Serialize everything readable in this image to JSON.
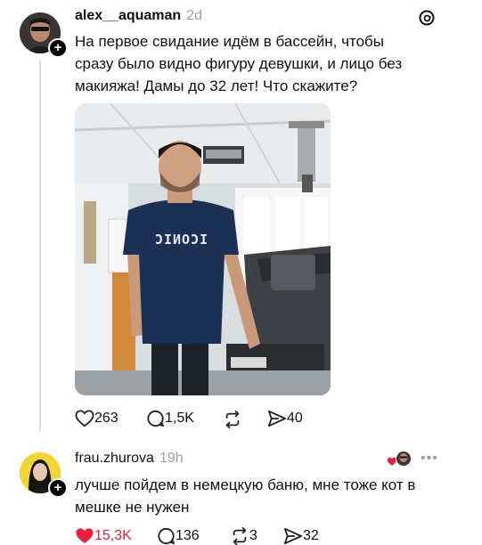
{
  "post": {
    "username": "alex__aquaman",
    "time": "2d",
    "text_lines": [
      "На первое свидание идём в бассейн, чтобы",
      "сразу было видно фигуру девушки, и лицо без",
      "макияжа! Дамы до 32 лет! Что скажите?"
    ],
    "photo_shirt_text": "ICONIC",
    "likes": "263",
    "comments": "1,5K",
    "shares": "40"
  },
  "reply": {
    "username": "frau.zhurova",
    "time": "19h",
    "text_lines": [
      "лучше пойдем в немецкую баню, мне тоже кот в",
      "мешке не нужен"
    ],
    "likes": "15,3K",
    "comments": "136",
    "reposts": "3",
    "shares": "32"
  },
  "colors": {
    "like_active": "#e8203a",
    "muted": "#a0a0a0"
  },
  "icons": [
    "threads-logo-icon",
    "heart-icon",
    "comment-icon",
    "repost-icon",
    "share-icon",
    "more-icon"
  ]
}
